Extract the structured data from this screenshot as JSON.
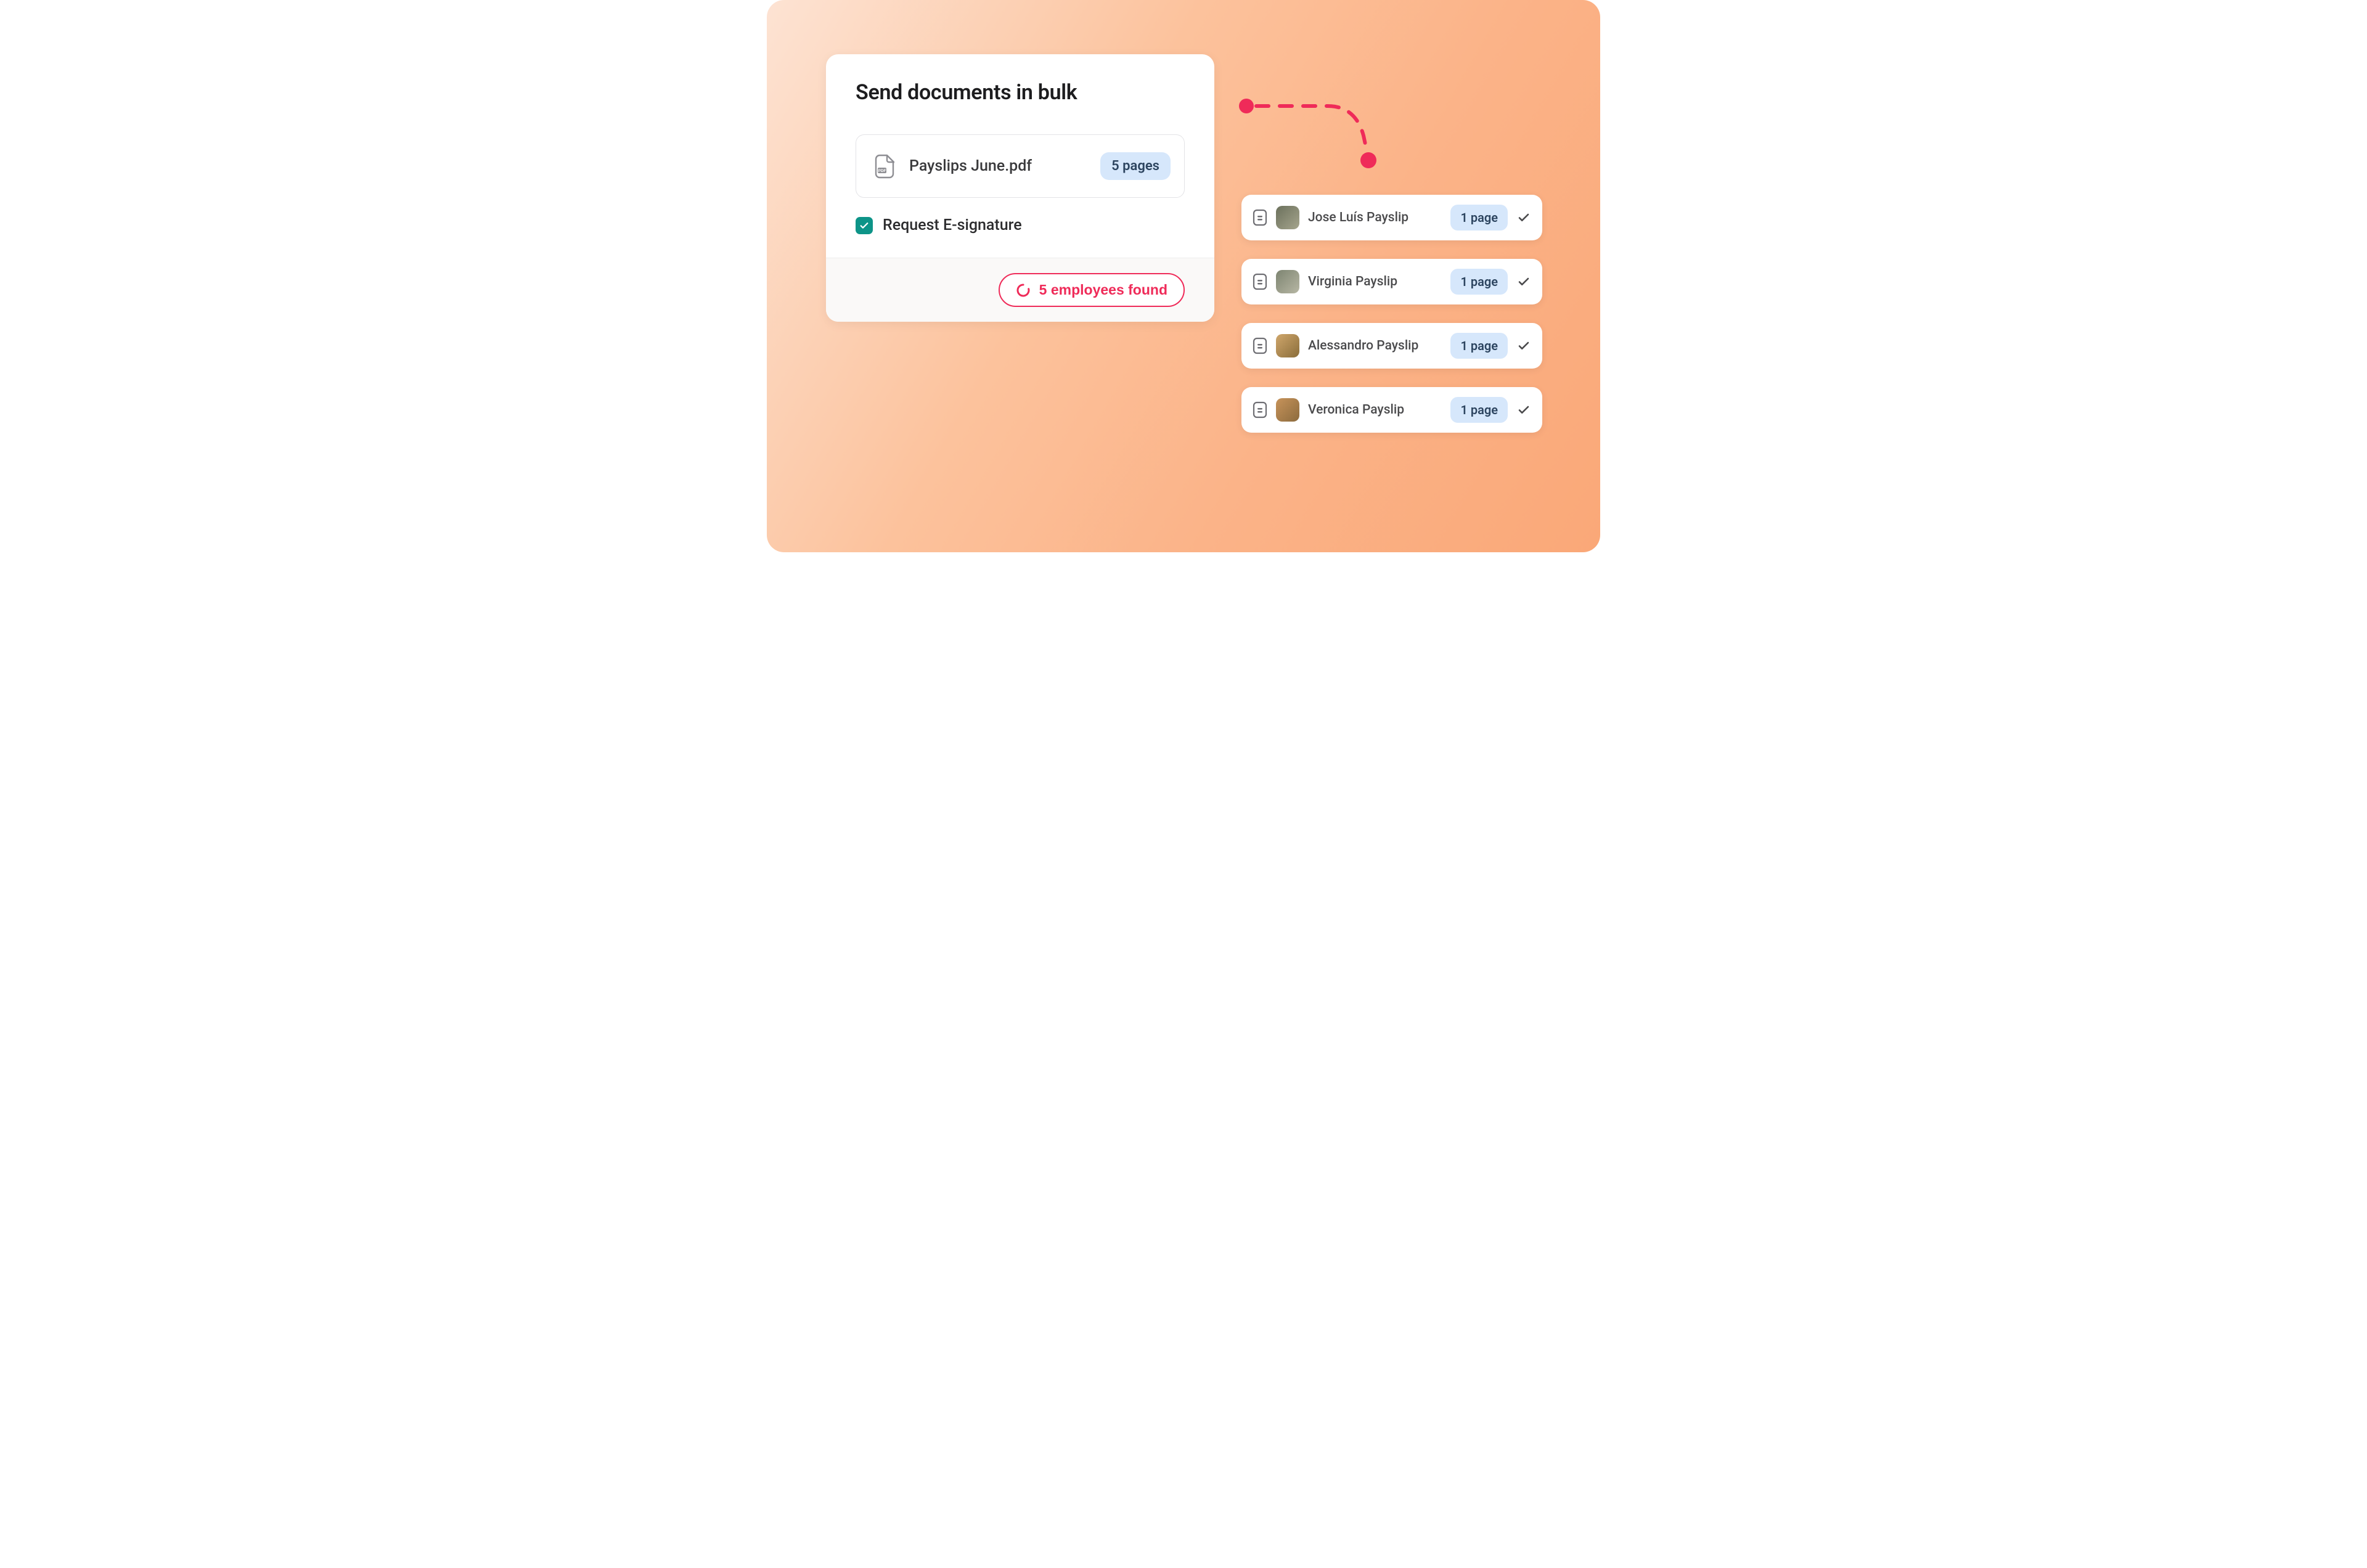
{
  "card": {
    "title": "Send documents in bulk",
    "file": {
      "name": "Payslips June.pdf",
      "pages_label": "5 pages"
    },
    "esign_label": "Request E-signature",
    "found_label": "5 employees found"
  },
  "results": [
    {
      "name": "Jose Luís Payslip",
      "pages": "1 page"
    },
    {
      "name": "Virginia Payslip",
      "pages": "1 page"
    },
    {
      "name": "Alessandro Payslip",
      "pages": "1 page"
    },
    {
      "name": "Veronica Payslip",
      "pages": "1 page"
    }
  ],
  "colors": {
    "accent_pink": "#ef2b59",
    "badge_blue_bg": "#d6e7fb",
    "teal": "#0d9488"
  }
}
